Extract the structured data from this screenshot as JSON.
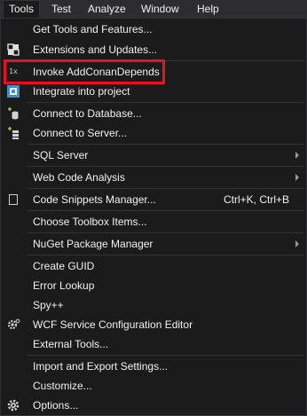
{
  "menubar": {
    "items": [
      {
        "label": "Tools"
      },
      {
        "label": "Test"
      },
      {
        "label": "Analyze"
      },
      {
        "label": "Window"
      },
      {
        "label": "Help"
      }
    ]
  },
  "menu": {
    "items": [
      {
        "label": "Get Tools and Features...",
        "icon": "none"
      },
      {
        "label": "Extensions and Updates...",
        "icon": "extensions-icon"
      },
      {
        "label": "Invoke AddConanDepends",
        "icon": "1x-icon",
        "icon_text": "1x"
      },
      {
        "label": "Integrate into project",
        "icon": "integrate-icon"
      },
      {
        "label": "Connect to Database...",
        "icon": "database-connect-icon"
      },
      {
        "label": "Connect to Server...",
        "icon": "server-connect-icon"
      },
      {
        "label": "SQL Server",
        "icon": "none",
        "submenu": true
      },
      {
        "label": "Web Code Analysis",
        "icon": "none",
        "submenu": true
      },
      {
        "label": "Code Snippets Manager...",
        "icon": "snippet-icon",
        "shortcut": "Ctrl+K, Ctrl+B"
      },
      {
        "label": "Choose Toolbox Items...",
        "icon": "none"
      },
      {
        "label": "NuGet Package Manager",
        "icon": "none",
        "submenu": true
      },
      {
        "label": "Create GUID",
        "icon": "none"
      },
      {
        "label": "Error Lookup",
        "icon": "none"
      },
      {
        "label": "Spy++",
        "icon": "none"
      },
      {
        "label": "WCF Service Configuration Editor",
        "icon": "wcf-gear-icon"
      },
      {
        "label": "External Tools...",
        "icon": "none"
      },
      {
        "label": "Import and Export Settings...",
        "icon": "none"
      },
      {
        "label": "Customize...",
        "icon": "none"
      },
      {
        "label": "Options...",
        "icon": "gear-icon"
      }
    ]
  },
  "colors": {
    "background": "#1b1b1c",
    "menubar": "#2d2d30",
    "text": "#f1f1f1",
    "separator": "#333337",
    "highlight_border": "#e81123",
    "icon_blue": "#3c8fd6"
  }
}
